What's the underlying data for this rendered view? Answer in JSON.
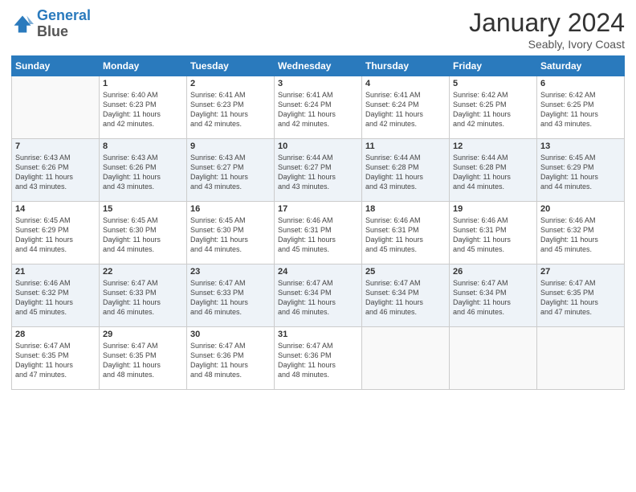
{
  "header": {
    "logo_line1": "General",
    "logo_line2": "Blue",
    "month": "January 2024",
    "location": "Seably, Ivory Coast"
  },
  "weekdays": [
    "Sunday",
    "Monday",
    "Tuesday",
    "Wednesday",
    "Thursday",
    "Friday",
    "Saturday"
  ],
  "weeks": [
    [
      {
        "day": "",
        "info": ""
      },
      {
        "day": "1",
        "info": "Sunrise: 6:40 AM\nSunset: 6:23 PM\nDaylight: 11 hours\nand 42 minutes."
      },
      {
        "day": "2",
        "info": "Sunrise: 6:41 AM\nSunset: 6:23 PM\nDaylight: 11 hours\nand 42 minutes."
      },
      {
        "day": "3",
        "info": "Sunrise: 6:41 AM\nSunset: 6:24 PM\nDaylight: 11 hours\nand 42 minutes."
      },
      {
        "day": "4",
        "info": "Sunrise: 6:41 AM\nSunset: 6:24 PM\nDaylight: 11 hours\nand 42 minutes."
      },
      {
        "day": "5",
        "info": "Sunrise: 6:42 AM\nSunset: 6:25 PM\nDaylight: 11 hours\nand 42 minutes."
      },
      {
        "day": "6",
        "info": "Sunrise: 6:42 AM\nSunset: 6:25 PM\nDaylight: 11 hours\nand 43 minutes."
      }
    ],
    [
      {
        "day": "7",
        "info": "Sunrise: 6:43 AM\nSunset: 6:26 PM\nDaylight: 11 hours\nand 43 minutes."
      },
      {
        "day": "8",
        "info": "Sunrise: 6:43 AM\nSunset: 6:26 PM\nDaylight: 11 hours\nand 43 minutes."
      },
      {
        "day": "9",
        "info": "Sunrise: 6:43 AM\nSunset: 6:27 PM\nDaylight: 11 hours\nand 43 minutes."
      },
      {
        "day": "10",
        "info": "Sunrise: 6:44 AM\nSunset: 6:27 PM\nDaylight: 11 hours\nand 43 minutes."
      },
      {
        "day": "11",
        "info": "Sunrise: 6:44 AM\nSunset: 6:28 PM\nDaylight: 11 hours\nand 43 minutes."
      },
      {
        "day": "12",
        "info": "Sunrise: 6:44 AM\nSunset: 6:28 PM\nDaylight: 11 hours\nand 44 minutes."
      },
      {
        "day": "13",
        "info": "Sunrise: 6:45 AM\nSunset: 6:29 PM\nDaylight: 11 hours\nand 44 minutes."
      }
    ],
    [
      {
        "day": "14",
        "info": "Sunrise: 6:45 AM\nSunset: 6:29 PM\nDaylight: 11 hours\nand 44 minutes."
      },
      {
        "day": "15",
        "info": "Sunrise: 6:45 AM\nSunset: 6:30 PM\nDaylight: 11 hours\nand 44 minutes."
      },
      {
        "day": "16",
        "info": "Sunrise: 6:45 AM\nSunset: 6:30 PM\nDaylight: 11 hours\nand 44 minutes."
      },
      {
        "day": "17",
        "info": "Sunrise: 6:46 AM\nSunset: 6:31 PM\nDaylight: 11 hours\nand 45 minutes."
      },
      {
        "day": "18",
        "info": "Sunrise: 6:46 AM\nSunset: 6:31 PM\nDaylight: 11 hours\nand 45 minutes."
      },
      {
        "day": "19",
        "info": "Sunrise: 6:46 AM\nSunset: 6:31 PM\nDaylight: 11 hours\nand 45 minutes."
      },
      {
        "day": "20",
        "info": "Sunrise: 6:46 AM\nSunset: 6:32 PM\nDaylight: 11 hours\nand 45 minutes."
      }
    ],
    [
      {
        "day": "21",
        "info": "Sunrise: 6:46 AM\nSunset: 6:32 PM\nDaylight: 11 hours\nand 45 minutes."
      },
      {
        "day": "22",
        "info": "Sunrise: 6:47 AM\nSunset: 6:33 PM\nDaylight: 11 hours\nand 46 minutes."
      },
      {
        "day": "23",
        "info": "Sunrise: 6:47 AM\nSunset: 6:33 PM\nDaylight: 11 hours\nand 46 minutes."
      },
      {
        "day": "24",
        "info": "Sunrise: 6:47 AM\nSunset: 6:34 PM\nDaylight: 11 hours\nand 46 minutes."
      },
      {
        "day": "25",
        "info": "Sunrise: 6:47 AM\nSunset: 6:34 PM\nDaylight: 11 hours\nand 46 minutes."
      },
      {
        "day": "26",
        "info": "Sunrise: 6:47 AM\nSunset: 6:34 PM\nDaylight: 11 hours\nand 46 minutes."
      },
      {
        "day": "27",
        "info": "Sunrise: 6:47 AM\nSunset: 6:35 PM\nDaylight: 11 hours\nand 47 minutes."
      }
    ],
    [
      {
        "day": "28",
        "info": "Sunrise: 6:47 AM\nSunset: 6:35 PM\nDaylight: 11 hours\nand 47 minutes."
      },
      {
        "day": "29",
        "info": "Sunrise: 6:47 AM\nSunset: 6:35 PM\nDaylight: 11 hours\nand 48 minutes."
      },
      {
        "day": "30",
        "info": "Sunrise: 6:47 AM\nSunset: 6:36 PM\nDaylight: 11 hours\nand 48 minutes."
      },
      {
        "day": "31",
        "info": "Sunrise: 6:47 AM\nSunset: 6:36 PM\nDaylight: 11 hours\nand 48 minutes."
      },
      {
        "day": "",
        "info": ""
      },
      {
        "day": "",
        "info": ""
      },
      {
        "day": "",
        "info": ""
      }
    ]
  ]
}
